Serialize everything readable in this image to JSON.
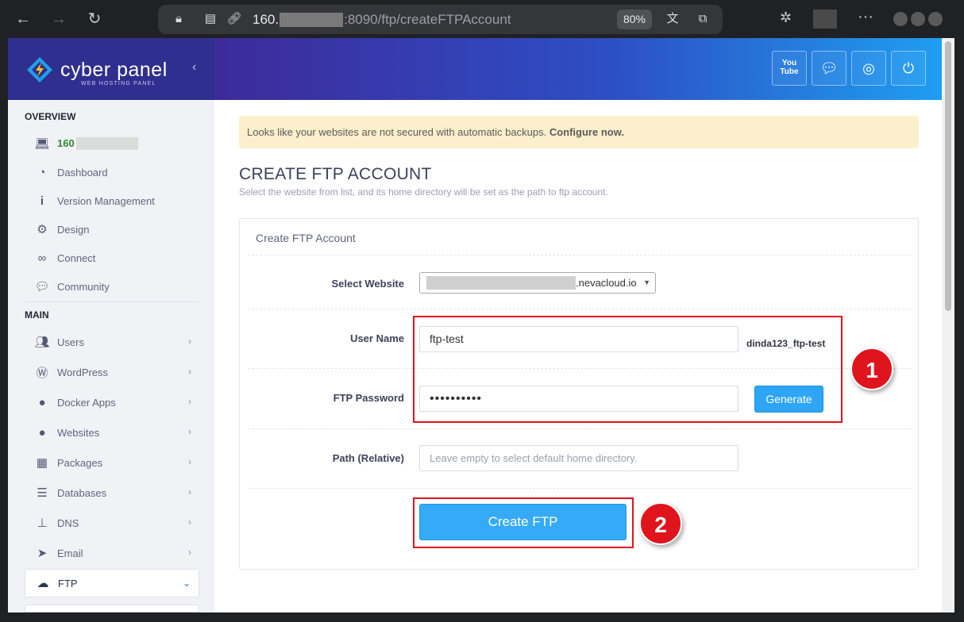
{
  "browser": {
    "back_icon": "arrow-left-icon",
    "url_prefix": "160.",
    "url_rest": ":8090/ftp/createFTPAccount",
    "zoom": "80%",
    "menu": "···"
  },
  "brand": {
    "name": "cyber panel",
    "tagline": "WEB HOSTING PANEL",
    "collapse": "‹",
    "colors": {
      "header_start": "#3d2a9a",
      "header_end": "#1e9ef2",
      "accent": "#2ea5f5"
    }
  },
  "sidebar": {
    "overview_label": "OVERVIEW",
    "main_label": "MAIN",
    "host": "160",
    "overview_items": [
      {
        "label": "Dashboard",
        "icon": "dashboard-icon"
      },
      {
        "label": "Version Management",
        "icon": "info-icon"
      },
      {
        "label": "Design",
        "icon": "gear-icon"
      },
      {
        "label": "Connect",
        "icon": "link-icon"
      },
      {
        "label": "Community",
        "icon": "chat-icon"
      }
    ],
    "main_items": [
      {
        "label": "Users",
        "icon": "users-icon"
      },
      {
        "label": "WordPress",
        "icon": "wordpress-icon"
      },
      {
        "label": "Docker Apps",
        "icon": "globe-icon"
      },
      {
        "label": "Websites",
        "icon": "globe-icon"
      },
      {
        "label": "Packages",
        "icon": "packages-icon"
      },
      {
        "label": "Databases",
        "icon": "database-icon"
      },
      {
        "label": "DNS",
        "icon": "sitemap-icon"
      },
      {
        "label": "Email",
        "icon": "paper-plane-icon"
      },
      {
        "label": "FTP",
        "icon": "cloud-upload-icon"
      }
    ]
  },
  "header": {
    "buttons": [
      {
        "name": "youtube-button",
        "icon": "youtube-icon",
        "label": "You\nTube"
      },
      {
        "name": "chat-button",
        "icon": "chat-icon"
      },
      {
        "name": "support-button",
        "icon": "lifebuoy-icon"
      },
      {
        "name": "logout-button",
        "icon": "power-icon"
      }
    ]
  },
  "alert": {
    "text": "Looks like your websites are not secured with automatic backups.",
    "link": "Configure now."
  },
  "page": {
    "title": "CREATE FTP ACCOUNT",
    "subtitle": "Select the website from list, and its home directory will be set as the path to ftp account."
  },
  "form": {
    "card_title": "Create FTP Account",
    "website_label": "Select Website",
    "website_value": ".nevacloud.io",
    "username_label": "User Name",
    "username_value": "ftp-test",
    "username_prefix": "dinda123_ftp-test",
    "password_label": "FTP Password",
    "password_value": "••••••••••",
    "generate_label": "Generate",
    "path_label": "Path (Relative)",
    "path_placeholder": "Leave empty to select default home directory.",
    "submit_label": "Create FTP"
  },
  "annotations": {
    "step1": "1",
    "step2": "2",
    "color": "#e0141d"
  }
}
